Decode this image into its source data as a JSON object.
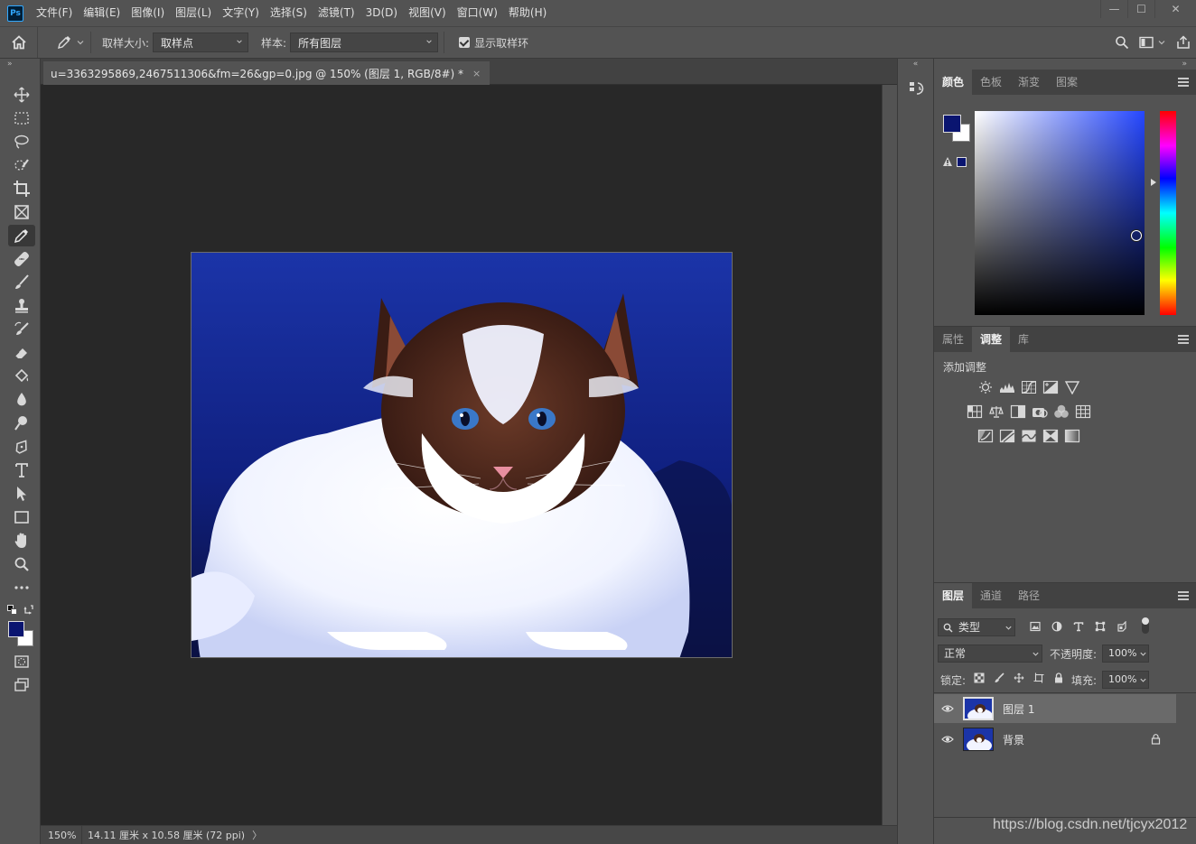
{
  "app": {
    "logo": "Ps"
  },
  "menu": [
    "文件(F)",
    "编辑(E)",
    "图像(I)",
    "图层(L)",
    "文字(Y)",
    "选择(S)",
    "滤镜(T)",
    "3D(D)",
    "视图(V)",
    "窗口(W)",
    "帮助(H)"
  ],
  "window_controls": {
    "minimize": "—",
    "restore": "☐",
    "close": "✕"
  },
  "options": {
    "sample_size_label": "取样大小:",
    "sample_size_value": "取样点",
    "sample_label": "样本:",
    "sample_value": "所有图层",
    "show_ring_label": "显示取样环",
    "show_ring_checked": true
  },
  "document": {
    "tab_title": "u=3363295869,2467511306&fm=26&gp=0.jpg @ 150% (图层 1, RGB/8#) *",
    "tab_close": "×",
    "zoom": "150%",
    "doc_info": "14.11 厘米 x 10.58 厘米 (72 ppi)",
    "status_arrow": "〉"
  },
  "colors": {
    "foreground": "#0a1570",
    "background": "#ffffff",
    "accent": "#31a8ff"
  },
  "color_panel": {
    "tabs": [
      "颜色",
      "色板",
      "渐变",
      "图案"
    ],
    "active_tab": 0
  },
  "props_panel": {
    "tabs": [
      "属性",
      "调整",
      "库"
    ],
    "active_tab": 1,
    "title": "添加调整"
  },
  "layers_panel": {
    "tabs": [
      "图层",
      "通道",
      "路径"
    ],
    "active_tab": 0,
    "filter_label": "类型",
    "blend_mode": "正常",
    "opacity_label": "不透明度:",
    "opacity_value": "100%",
    "lock_label": "锁定:",
    "fill_label": "填充:",
    "fill_value": "100%",
    "layers": [
      {
        "name": "图层 1",
        "selected": true,
        "locked": false
      },
      {
        "name": "背景",
        "selected": false,
        "locked": true
      }
    ]
  },
  "watermark": "https://blog.csdn.net/tjcyx2012"
}
